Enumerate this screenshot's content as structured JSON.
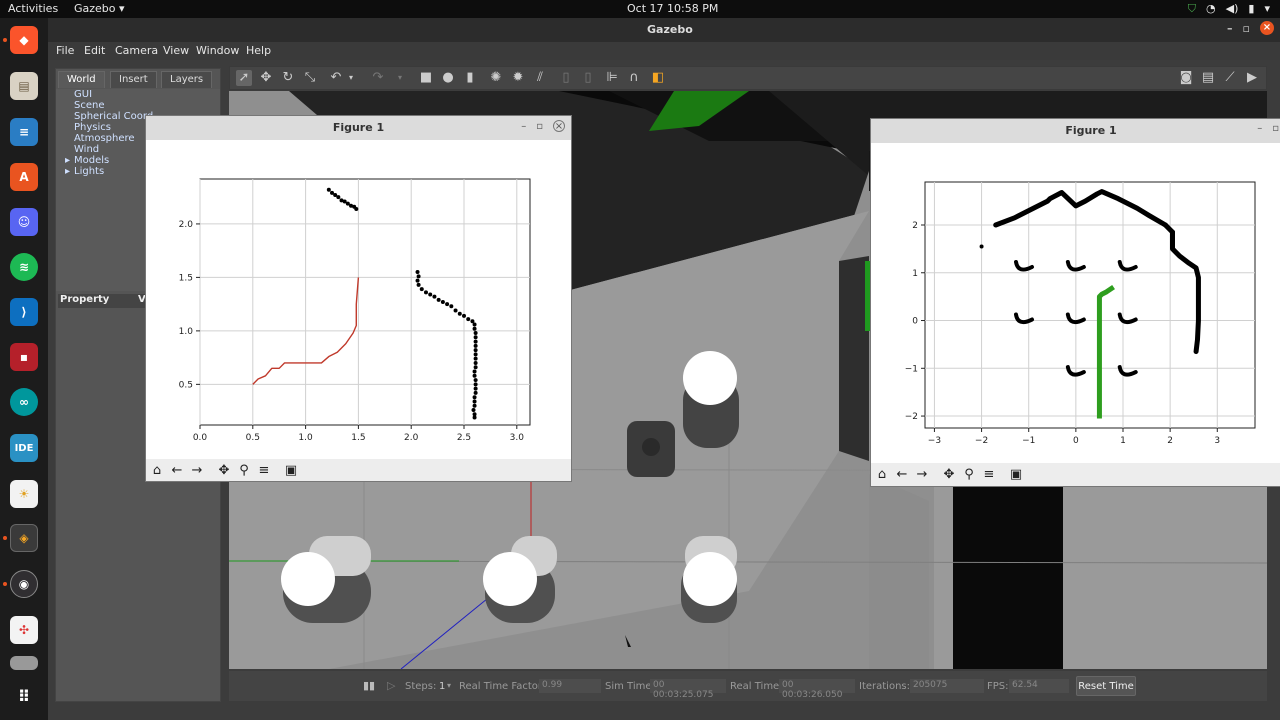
{
  "topbar": {
    "activities": "Activities",
    "app_menu": "Gazebo ▾",
    "clock": "Oct 17  10:58 PM"
  },
  "gazebo": {
    "title": "Gazebo",
    "menu": [
      "File",
      "Edit",
      "Camera",
      "View",
      "Window",
      "Help"
    ],
    "tabs": [
      "World",
      "Insert",
      "Layers"
    ],
    "tree": [
      "GUI",
      "Scene",
      "Spherical Coord",
      "Physics",
      "Atmosphere",
      "Wind",
      "Models",
      "Lights"
    ],
    "property_header": "Property",
    "property_value_header": "V"
  },
  "status": {
    "steps_label": "Steps:",
    "steps_value": "1",
    "rtf_label": "Real Time Factor:",
    "rtf_value": "0.99",
    "sim_label": "Sim Time:",
    "sim_value": "00 00:03:25.075",
    "real_label": "Real Time:",
    "real_value": "00 00:03:26.050",
    "iter_label": "Iterations:",
    "iter_value": "205075",
    "fps_label": "FPS:",
    "fps_value": "62.54",
    "reset": "Reset Time"
  },
  "figures": [
    {
      "title": "Figure 1"
    },
    {
      "title": "Figure 1"
    }
  ],
  "chart_data": [
    {
      "type": "scatter",
      "xlim": [
        0.0,
        3.125
      ],
      "ylim": [
        0.12,
        2.42
      ],
      "xticks": [
        "0.0",
        "0.5",
        "1.0",
        "1.5",
        "2.0",
        "2.5",
        "3.0"
      ],
      "xtick_values": [
        0.0,
        0.5,
        1.0,
        1.5,
        2.0,
        2.5,
        3.0
      ],
      "yticks": [
        "0.5",
        "1.0",
        "1.5",
        "2.0"
      ],
      "ytick_values": [
        0.5,
        1.0,
        1.5,
        2.0
      ],
      "grid": true,
      "path_color": "#c0392b",
      "path": [
        [
          0.5,
          0.5
        ],
        [
          0.55,
          0.55
        ],
        [
          0.62,
          0.58
        ],
        [
          0.68,
          0.65
        ],
        [
          0.75,
          0.65
        ],
        [
          0.8,
          0.7
        ],
        [
          1.15,
          0.7
        ],
        [
          1.22,
          0.76
        ],
        [
          1.3,
          0.8
        ],
        [
          1.38,
          0.88
        ],
        [
          1.45,
          0.98
        ],
        [
          1.48,
          1.05
        ],
        [
          1.48,
          1.25
        ],
        [
          1.5,
          1.5
        ]
      ],
      "points": [
        [
          1.22,
          2.32
        ],
        [
          1.25,
          2.29
        ],
        [
          1.28,
          2.27
        ],
        [
          1.31,
          2.25
        ],
        [
          1.34,
          2.22
        ],
        [
          1.37,
          2.21
        ],
        [
          1.4,
          2.19
        ],
        [
          1.43,
          2.17
        ],
        [
          1.46,
          2.16
        ],
        [
          1.48,
          2.14
        ],
        [
          2.06,
          1.55
        ],
        [
          2.07,
          1.51
        ],
        [
          2.06,
          1.47
        ],
        [
          2.07,
          1.43
        ],
        [
          2.1,
          1.39
        ],
        [
          2.14,
          1.36
        ],
        [
          2.18,
          1.34
        ],
        [
          2.22,
          1.32
        ],
        [
          2.26,
          1.29
        ],
        [
          2.3,
          1.27
        ],
        [
          2.34,
          1.25
        ],
        [
          2.38,
          1.23
        ],
        [
          2.42,
          1.19
        ],
        [
          2.46,
          1.16
        ],
        [
          2.5,
          1.14
        ],
        [
          2.54,
          1.11
        ],
        [
          2.58,
          1.09
        ],
        [
          2.6,
          1.06
        ],
        [
          2.6,
          1.02
        ],
        [
          2.61,
          0.98
        ],
        [
          2.61,
          0.94
        ],
        [
          2.61,
          0.9
        ],
        [
          2.61,
          0.86
        ],
        [
          2.61,
          0.82
        ],
        [
          2.61,
          0.78
        ],
        [
          2.61,
          0.74
        ],
        [
          2.61,
          0.7
        ],
        [
          2.61,
          0.66
        ],
        [
          2.6,
          0.62
        ],
        [
          2.6,
          0.58
        ],
        [
          2.61,
          0.54
        ],
        [
          2.61,
          0.5
        ],
        [
          2.61,
          0.46
        ],
        [
          2.61,
          0.42
        ],
        [
          2.6,
          0.38
        ],
        [
          2.6,
          0.34
        ],
        [
          2.6,
          0.3
        ],
        [
          2.59,
          0.26
        ],
        [
          2.6,
          0.22
        ],
        [
          2.6,
          0.19
        ]
      ]
    },
    {
      "type": "scatter",
      "xlim": [
        -3.2,
        3.8
      ],
      "ylim": [
        -2.25,
        2.9
      ],
      "xticks": [
        "−3",
        "−2",
        "−1",
        "0",
        "1",
        "2",
        "3"
      ],
      "xtick_values": [
        -3,
        -2,
        -1,
        0,
        1,
        2,
        3
      ],
      "yticks": [
        "−2",
        "−1",
        "0",
        "1",
        "2"
      ],
      "ytick_values": [
        -2,
        -1,
        0,
        1,
        2
      ],
      "grid": true,
      "path_color": "#2e9e1e",
      "path": [
        [
          0.5,
          -2.05
        ],
        [
          0.5,
          0.5
        ],
        [
          0.55,
          0.55
        ],
        [
          0.65,
          0.6
        ],
        [
          0.8,
          0.7
        ]
      ],
      "walls": [
        [
          [
            -1.7,
            2.0
          ],
          [
            -1.3,
            2.15
          ],
          [
            -0.9,
            2.35
          ],
          [
            -0.6,
            2.5
          ],
          [
            -0.55,
            2.55
          ],
          [
            -0.3,
            2.68
          ],
          [
            0.0,
            2.4
          ],
          [
            0.2,
            2.5
          ],
          [
            0.45,
            2.65
          ],
          [
            0.55,
            2.7
          ],
          [
            0.9,
            2.55
          ],
          [
            1.3,
            2.35
          ],
          [
            1.55,
            2.2
          ],
          [
            1.9,
            2.0
          ]
        ],
        [
          [
            1.9,
            2.0
          ],
          [
            2.05,
            1.85
          ]
        ],
        [
          [
            2.05,
            1.85
          ],
          [
            2.05,
            1.5
          ],
          [
            2.2,
            1.35
          ],
          [
            2.4,
            1.2
          ],
          [
            2.55,
            1.1
          ],
          [
            2.6,
            0.9
          ],
          [
            2.6,
            0.5
          ],
          [
            2.6,
            0.0
          ],
          [
            2.58,
            -0.4
          ],
          [
            2.55,
            -0.65
          ]
        ]
      ],
      "points": [
        [
          -2.0,
          1.55
        ]
      ],
      "arcs": [
        [
          -1.1,
          1.1
        ],
        [
          0.0,
          1.1
        ],
        [
          1.1,
          1.1
        ],
        [
          -1.1,
          0.0
        ],
        [
          0.0,
          0.0
        ],
        [
          1.1,
          0.0
        ],
        [
          0.0,
          -1.1
        ],
        [
          1.1,
          -1.1
        ]
      ]
    }
  ]
}
